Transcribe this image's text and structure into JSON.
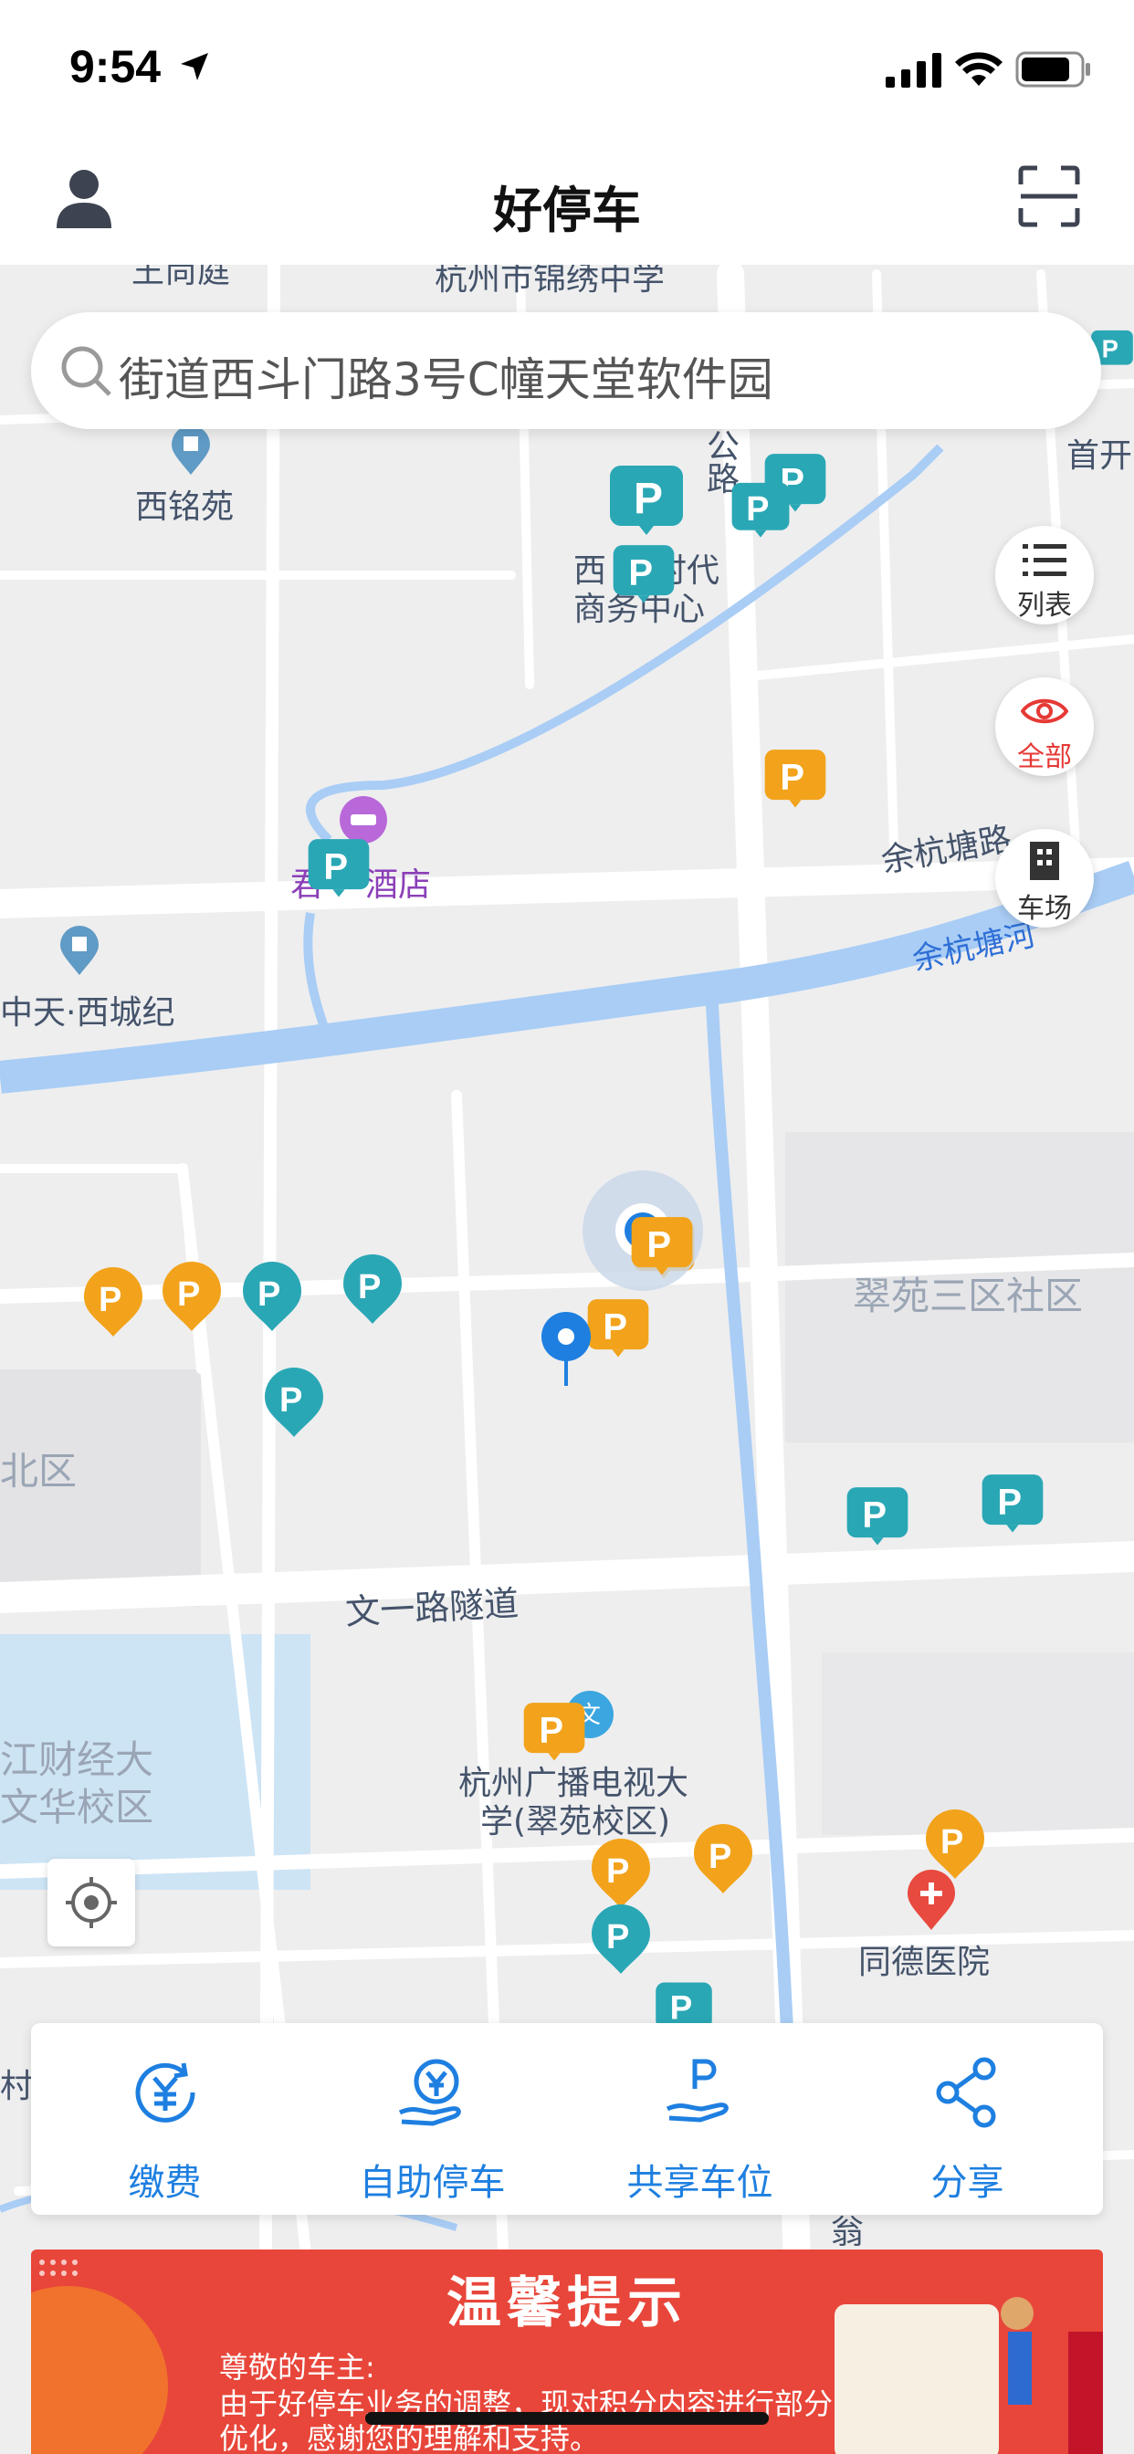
{
  "status_bar": {
    "time": "9:54"
  },
  "nav": {
    "title": "好停车"
  },
  "search": {
    "value": "街道西斗门路3号C幢天堂软件园"
  },
  "side_buttons": {
    "list": "列表",
    "all": "全部",
    "lots": "车场"
  },
  "map_labels": {
    "school": "杭州市锦绣中学",
    "top_left": "王尚庭",
    "ximing": "西铭苑",
    "road_gong": "公",
    "road_lu": "路",
    "shouka": "首开",
    "center_a": "西",
    "center_b": "时代",
    "center_c": "商务中心",
    "hotel_a": "君",
    "hotel_b": "酒店",
    "yuhang_road": "余杭塘路",
    "yuhang_river": "余杭塘河",
    "tiancheng": "中天·西城纪",
    "cuiyuan": "翠苑三区社区",
    "beiqu": "北区",
    "wenyi": "文一路隧道",
    "caijing_a": "江财经大",
    "caijing_b": "文华校区",
    "guangbo_a": "杭州广播电视大",
    "guangbo_b": "学(翠苑校区)",
    "tongde": "同德医院",
    "cun": "村",
    "weng": "翁",
    "wen_badge": "文"
  },
  "actions": [
    {
      "label": "缴费",
      "icon": "yuan-pay-icon"
    },
    {
      "label": "自助停车",
      "icon": "yuan-hand-icon"
    },
    {
      "label": "共享车位",
      "icon": "parking-hand-icon"
    },
    {
      "label": "分享",
      "icon": "share-icon"
    }
  ],
  "banner": {
    "title": "温馨提示",
    "greeting": "尊敬的车主:",
    "body": "由于好停车业务的调整，现对积分内容进行部分优化，感谢您的理解和支持。"
  },
  "colors": {
    "accent": "#1e7fe0",
    "teal_pin": "#2aa7b5",
    "orange_pin": "#f2a31b",
    "banner": "#e8463a"
  }
}
